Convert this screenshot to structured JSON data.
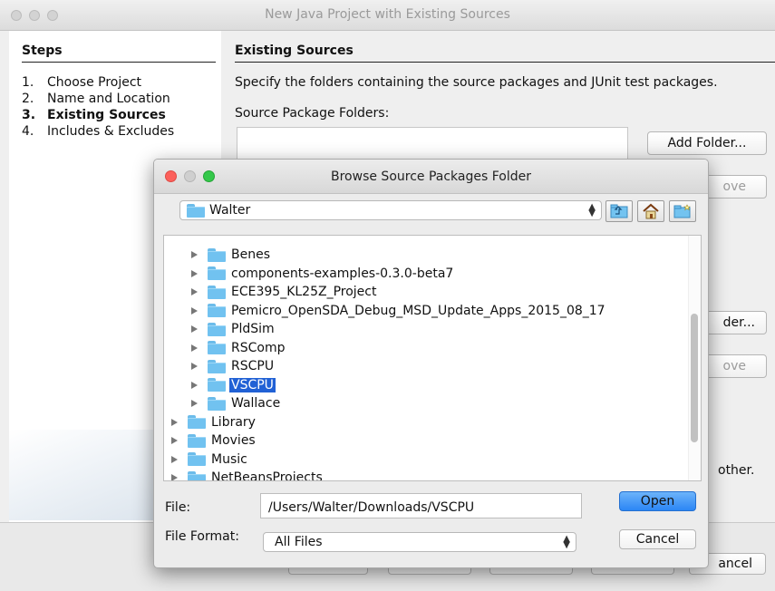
{
  "wizard": {
    "title": "New Java Project with Existing Sources",
    "steps_heading": "Steps",
    "steps": [
      {
        "num": "1.",
        "label": "Choose Project"
      },
      {
        "num": "2.",
        "label": "Name and Location"
      },
      {
        "num": "3.",
        "label": "Existing Sources"
      },
      {
        "num": "4.",
        "label": "Includes & Excludes"
      }
    ],
    "current_step": 3,
    "section_heading": "Existing Sources",
    "description": "Specify the folders containing the source packages and JUnit test packages.",
    "source_label": "Source Package Folders:",
    "add_folder_label": "Add Folder...",
    "remove_fragment_1": "ove",
    "add_folder_fragment_2": "der...",
    "remove_fragment_2": "ove",
    "other_fragment": "other.",
    "cancel_fragment": "ancel"
  },
  "dialog": {
    "title": "Browse Source Packages Folder",
    "current_folder": "Walter",
    "toolbar": {
      "up_icon": "up-folder-icon",
      "home_icon": "home-icon",
      "new_folder_icon": "new-folder-icon"
    },
    "tree": [
      {
        "label": "Benes",
        "level": 2
      },
      {
        "label": "components-examples-0.3.0-beta7",
        "level": 2
      },
      {
        "label": "ECE395_KL25Z_Project",
        "level": 2
      },
      {
        "label": "Pemicro_OpenSDA_Debug_MSD_Update_Apps_2015_08_17",
        "level": 2
      },
      {
        "label": "PldSim",
        "level": 2
      },
      {
        "label": "RSComp",
        "level": 2
      },
      {
        "label": "RSCPU",
        "level": 2
      },
      {
        "label": "VSCPU",
        "level": 2,
        "selected": true
      },
      {
        "label": "Wallace",
        "level": 2
      },
      {
        "label": "Library",
        "level": 1
      },
      {
        "label": "Movies",
        "level": 1
      },
      {
        "label": "Music",
        "level": 1
      },
      {
        "label": "NetBeansProjects",
        "level": 1
      }
    ],
    "file_label": "File:",
    "file_value": "/Users/Walter/Downloads/VSCPU",
    "format_label": "File Format:",
    "format_value": "All Files",
    "open_label": "Open",
    "cancel_label": "Cancel"
  },
  "colors": {
    "selection": "#2161d5",
    "folder": "#71c2f0",
    "primary_button": "#2b86f5"
  }
}
